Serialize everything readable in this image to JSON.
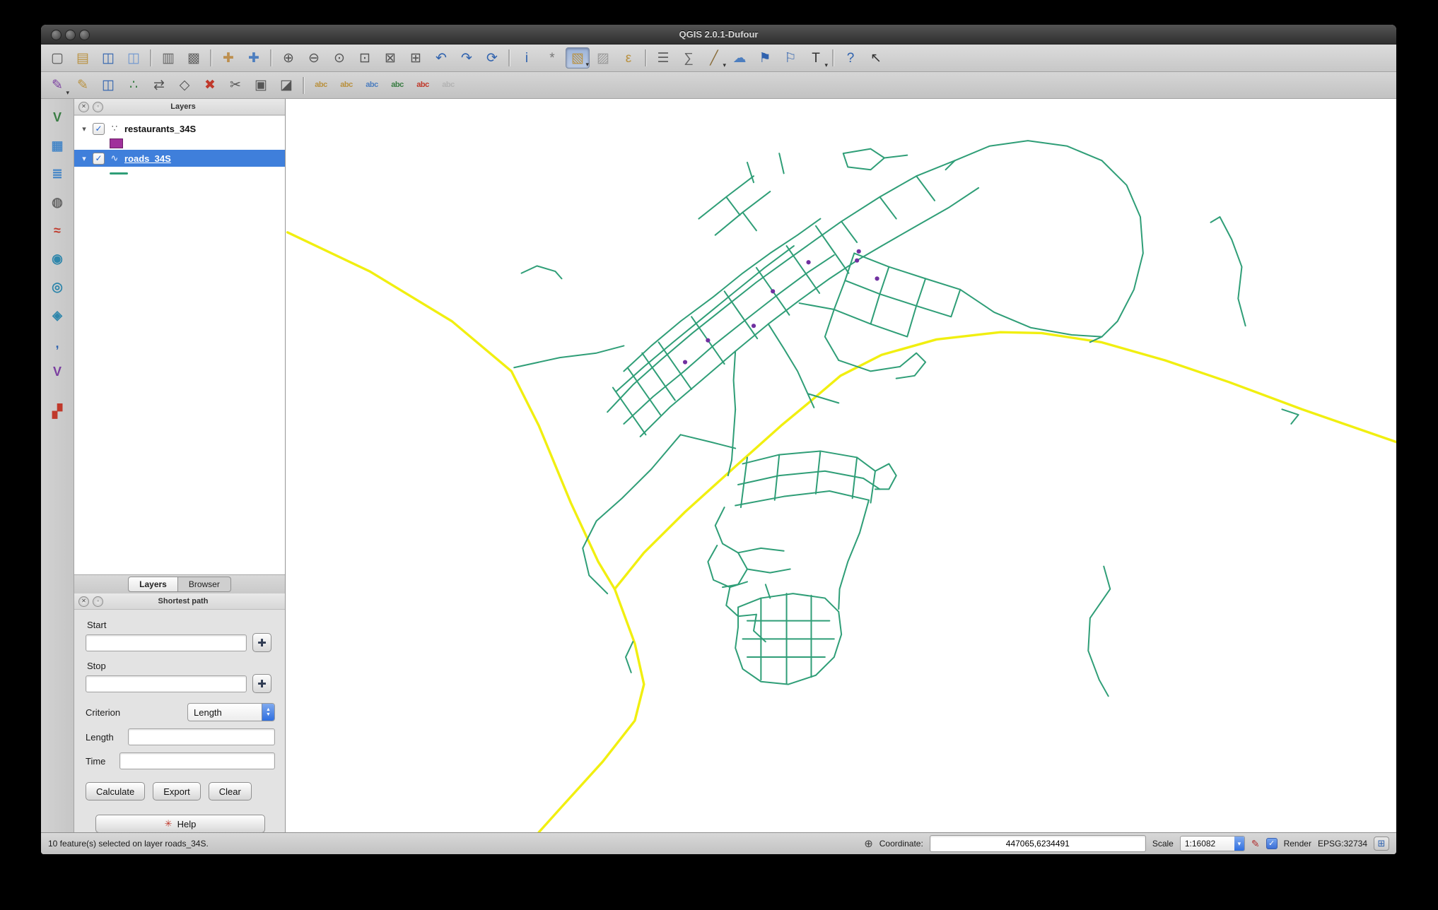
{
  "window": {
    "title": "QGIS 2.0.1-Dufour"
  },
  "icons": {
    "close": "✕",
    "float": "▫",
    "check": "✓",
    "disclosure": "▾",
    "crosshair": "✚",
    "point_layer": "∵",
    "line_layer": "∿",
    "coordinate": "⊕",
    "pen": "✎",
    "combo_arrow": "▾",
    "stepper_up": "▲",
    "stepper_down": "▼",
    "help_red": "✳",
    "crs": "⊞"
  },
  "toolbar_main": {
    "items": [
      {
        "name": "new-project-button",
        "icon": "new-project-icon",
        "glyph": "▢",
        "color": "#555555"
      },
      {
        "name": "open-project-button",
        "icon": "open-project-icon",
        "glyph": "▤",
        "color": "#b9913f"
      },
      {
        "name": "save-project-button",
        "icon": "save-icon",
        "glyph": "◫",
        "color": "#2f62ae"
      },
      {
        "name": "save-project-as-button",
        "icon": "save-as-icon",
        "glyph": "◫",
        "color": "#6e96cf"
      },
      {
        "sep": true
      },
      {
        "name": "new-print-composer-button",
        "icon": "new-composer-icon",
        "glyph": "▥",
        "color": "#666666"
      },
      {
        "name": "composer-manager-button",
        "icon": "composer-manager-icon",
        "glyph": "▩",
        "color": "#666666"
      },
      {
        "sep": true
      },
      {
        "name": "pan-map-button",
        "icon": "pan-hand-icon",
        "glyph": "✚",
        "color": "#bd8f4e"
      },
      {
        "name": "pan-to-selection-button",
        "icon": "pan-selection-icon",
        "glyph": "✚",
        "color": "#4d7ebf"
      },
      {
        "sep": true
      },
      {
        "name": "zoom-in-button",
        "icon": "zoom-in-icon",
        "glyph": "⊕",
        "color": "#555555"
      },
      {
        "name": "zoom-out-button",
        "icon": "zoom-out-icon",
        "glyph": "⊖",
        "color": "#555555"
      },
      {
        "name": "zoom-actual-button",
        "icon": "zoom-actual-icon",
        "glyph": "⊙",
        "color": "#555555"
      },
      {
        "name": "zoom-full-button",
        "icon": "zoom-full-icon",
        "glyph": "⊡",
        "color": "#555555"
      },
      {
        "name": "zoom-to-selection-button",
        "icon": "zoom-selection-icon",
        "glyph": "⊠",
        "color": "#555555"
      },
      {
        "name": "zoom-to-layer-button",
        "icon": "zoom-layer-icon",
        "glyph": "⊞",
        "color": "#555555"
      },
      {
        "name": "zoom-last-button",
        "icon": "zoom-last-icon",
        "glyph": "↶",
        "color": "#2f62ae"
      },
      {
        "name": "zoom-next-button",
        "icon": "zoom-next-icon",
        "glyph": "↷",
        "color": "#2f62ae"
      },
      {
        "name": "map-refresh-button",
        "icon": "refresh-icon",
        "glyph": "⟳",
        "color": "#2f62ae"
      },
      {
        "sep": true
      },
      {
        "name": "identify-button",
        "icon": "identify-icon",
        "glyph": "i",
        "color": "#2f62ae"
      },
      {
        "name": "run-feature-action-button",
        "icon": "action-icon",
        "glyph": "*",
        "color": "#777777"
      },
      {
        "name": "select-rectangle-button",
        "icon": "select-rectangle-icon",
        "glyph": "▧",
        "color": "#b9913f",
        "pressed": true,
        "caret": true
      },
      {
        "name": "deselect-all-button",
        "icon": "deselect-icon",
        "glyph": "▨",
        "color": "#999999"
      },
      {
        "name": "select-by-expression-button",
        "icon": "expression-icon",
        "glyph": "ε",
        "color": "#b9913f"
      },
      {
        "sep": true
      },
      {
        "name": "open-attribute-table-button",
        "icon": "attribute-table-icon",
        "glyph": "☰",
        "color": "#666666"
      },
      {
        "name": "field-calculator-button",
        "icon": "field-calculator-icon",
        "glyph": "∑",
        "color": "#666666"
      },
      {
        "name": "measure-button",
        "icon": "measure-icon",
        "glyph": "╱",
        "color": "#8a6d3b",
        "caret": true
      },
      {
        "name": "map-tips-button",
        "icon": "map-tips-icon",
        "glyph": "☁",
        "color": "#4d7ebf"
      },
      {
        "name": "new-bookmark-button",
        "icon": "new-bookmark-icon",
        "glyph": "⚑",
        "color": "#2f62ae"
      },
      {
        "name": "show-bookmarks-button",
        "icon": "show-bookmarks-icon",
        "glyph": "⚐",
        "color": "#2f62ae"
      },
      {
        "name": "text-annotation-button",
        "icon": "text-annotation-icon",
        "glyph": "T",
        "color": "#333333",
        "caret": true
      },
      {
        "sep": true
      },
      {
        "name": "help-button",
        "icon": "help-contents-icon",
        "glyph": "?",
        "color": "#2f62ae"
      },
      {
        "name": "whats-this-button",
        "icon": "whats-this-icon",
        "glyph": "↖",
        "color": "#333333"
      }
    ]
  },
  "toolbar_digitizing": {
    "items": [
      {
        "name": "current-edits-button",
        "icon": "current-edits-icon",
        "glyph": "✎",
        "color": "#7b3fa0",
        "caret": true
      },
      {
        "name": "toggle-editing-button",
        "icon": "toggle-editing-icon",
        "glyph": "✎",
        "color": "#b9913f"
      },
      {
        "name": "save-layer-edits-button",
        "icon": "save-edits-icon",
        "glyph": "◫",
        "color": "#2f62ae"
      },
      {
        "name": "add-feature-button",
        "icon": "add-feature-icon",
        "glyph": "∴",
        "color": "#3a7d44"
      },
      {
        "name": "move-feature-button",
        "icon": "move-feature-icon",
        "glyph": "⇄",
        "color": "#555555"
      },
      {
        "name": "node-tool-button",
        "icon": "node-tool-icon",
        "glyph": "◇",
        "color": "#555555"
      },
      {
        "name": "delete-selected-button",
        "icon": "delete-selected-icon",
        "glyph": "✖",
        "color": "#c0392b"
      },
      {
        "name": "cut-features-button",
        "icon": "cut-icon",
        "glyph": "✂",
        "color": "#555555"
      },
      {
        "name": "copy-features-button",
        "icon": "copy-icon",
        "glyph": "▣",
        "color": "#555555"
      },
      {
        "name": "paste-features-button",
        "icon": "paste-icon",
        "glyph": "◪",
        "color": "#555555"
      },
      {
        "sep": true
      },
      {
        "name": "labeling-button",
        "icon": "labeling-icon",
        "glyph": "abc",
        "color": "#b9913f",
        "small": true
      },
      {
        "name": "label-move-button",
        "icon": "label-move-icon",
        "glyph": "abc",
        "color": "#b9913f",
        "small": true
      },
      {
        "name": "label-rotate-button",
        "icon": "label-rotate-icon",
        "glyph": "abc",
        "color": "#4d7ebf",
        "small": true
      },
      {
        "name": "label-pin-button",
        "icon": "label-pin-icon",
        "glyph": "abc",
        "color": "#3a7d44",
        "small": true
      },
      {
        "name": "label-show-hide-button",
        "icon": "label-show-hide-icon",
        "glyph": "abc",
        "color": "#c0392b",
        "small": true
      },
      {
        "name": "label-properties-button",
        "icon": "label-properties-icon",
        "glyph": "abc",
        "color": "#888888",
        "small": true,
        "disabled": true
      }
    ]
  },
  "toolbar_layers": {
    "items": [
      {
        "name": "add-vector-layer-button",
        "icon": "add-vector-icon",
        "glyph": "V",
        "color": "#3a7d44"
      },
      {
        "name": "add-raster-layer-button",
        "icon": "add-raster-icon",
        "glyph": "▦",
        "color": "#4787c7"
      },
      {
        "name": "add-postgis-layer-button",
        "icon": "add-postgis-icon",
        "glyph": "≣",
        "color": "#4787c7"
      },
      {
        "name": "add-spatialite-layer-button",
        "icon": "add-spatialite-icon",
        "glyph": "◍",
        "color": "#666666"
      },
      {
        "name": "add-mssql-layer-button",
        "icon": "add-mssql-icon",
        "glyph": "≈",
        "color": "#c0392b"
      },
      {
        "name": "add-wms-layer-button",
        "icon": "add-wms-icon",
        "glyph": "◉",
        "color": "#2e86ab"
      },
      {
        "name": "add-wcs-layer-button",
        "icon": "add-wcs-icon",
        "glyph": "◎",
        "color": "#2e86ab"
      },
      {
        "name": "add-wfs-layer-button",
        "icon": "add-wfs-icon",
        "glyph": "◈",
        "color": "#2e86ab"
      },
      {
        "name": "add-delimited-text-layer-button",
        "icon": "delimited-text-icon",
        "glyph": ",",
        "color": "#2f62ae"
      },
      {
        "name": "new-shapefile-layer-button",
        "icon": "new-shapefile-icon",
        "glyph": "V",
        "color": "#7b3fa0"
      },
      {
        "name": "add-oracle-layer-button",
        "icon": "add-oracle-icon",
        "glyph": "▞",
        "color": "#c0392b",
        "gap": true
      }
    ]
  },
  "layers_panel": {
    "title": "Layers",
    "tabs": [
      {
        "label": "Layers",
        "active": true
      },
      {
        "label": "Browser"
      }
    ],
    "layers": [
      {
        "label": "restaurants_34S",
        "checked": true,
        "swatch_color": "#a0309b",
        "type": "point"
      },
      {
        "label": "roads_34S",
        "checked": true,
        "swatch_color": "#2f9e77",
        "type": "line",
        "selected": true
      }
    ]
  },
  "shortest_path_panel": {
    "title": "Shortest path",
    "start_label": "Start",
    "start_value": "",
    "stop_label": "Stop",
    "stop_value": "",
    "criterion_label": "Criterion",
    "criterion_value": "Length",
    "length_label": "Length",
    "length_value": "",
    "time_label": "Time",
    "time_value": "",
    "calculate_label": "Calculate",
    "export_label": "Export",
    "clear_label": "Clear",
    "help_label": "Help"
  },
  "status_bar": {
    "message": "10 feature(s) selected on layer roads_34S.",
    "coordinate_label": "Coordinate:",
    "coordinate_value": "447065,6234491",
    "scale_label": "Scale",
    "scale_value": "1:16082",
    "render_label": "Render",
    "crs_label": "EPSG:32734"
  },
  "map": {
    "colors": {
      "green": "#2f9e77",
      "yellow": "#f1ef10",
      "background": "#ffffff",
      "marker": "#7030a0"
    }
  }
}
